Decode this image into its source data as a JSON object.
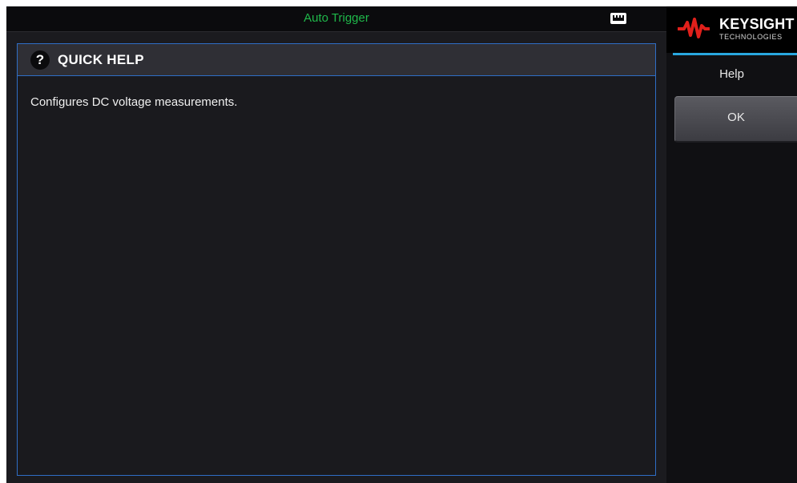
{
  "status_bar": {
    "trigger_mode": "Auto Trigger",
    "lan_icon": "network-port-icon"
  },
  "quick_help": {
    "badge": "?",
    "title": "QUICK HELP",
    "body": "Configures DC voltage measurements."
  },
  "sidebar": {
    "brand": "KEYSIGHT",
    "brand_sub": "TECHNOLOGIES",
    "menu_title": "Help",
    "softkeys": [
      {
        "label": "OK"
      }
    ]
  },
  "colors": {
    "status_green": "#1fb84a",
    "panel_border": "#2f6ec6",
    "accent_blue": "#29a7df",
    "logo_red": "#e0201b"
  }
}
